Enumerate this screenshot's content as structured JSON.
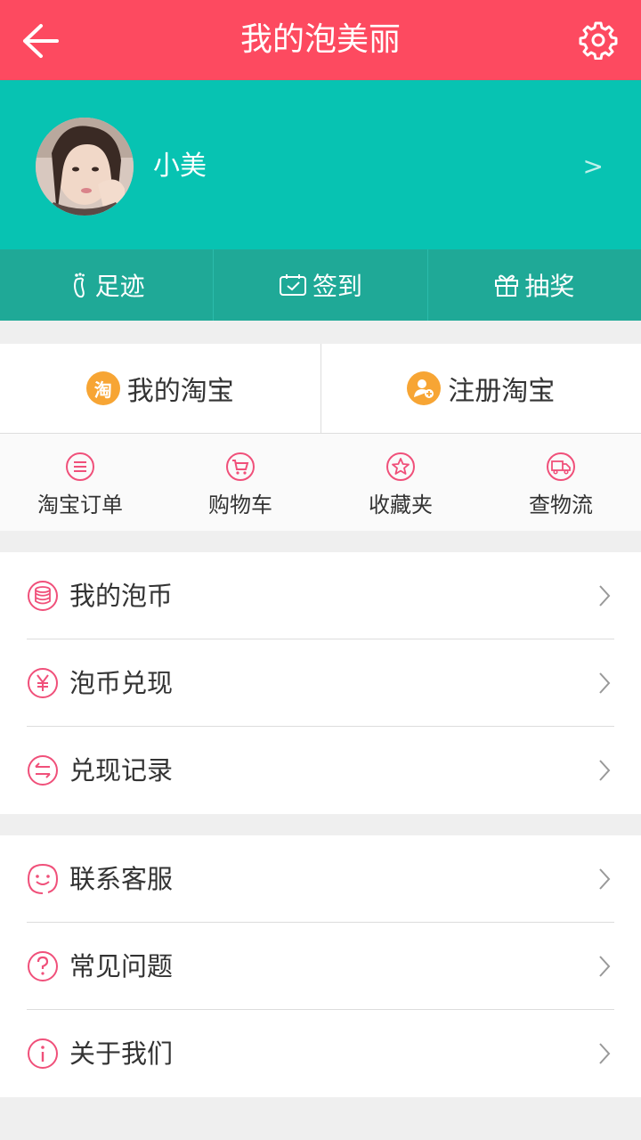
{
  "header": {
    "title": "我的泡美丽",
    "back_icon": "arrow-left-icon",
    "settings_icon": "gear-icon"
  },
  "profile": {
    "username": "小美",
    "chevron": ">"
  },
  "actions": [
    {
      "label": "足迹",
      "icon": "footprint-icon"
    },
    {
      "label": "签到",
      "icon": "calendar-check-icon"
    },
    {
      "label": "抽奖",
      "icon": "gift-icon"
    }
  ],
  "taobao": [
    {
      "label": "我的淘宝",
      "icon_char": "淘"
    },
    {
      "label": "注册淘宝",
      "icon": "add-user-icon"
    }
  ],
  "quick": [
    {
      "label": "淘宝订单",
      "icon": "list-icon"
    },
    {
      "label": "购物车",
      "icon": "cart-icon"
    },
    {
      "label": "收藏夹",
      "icon": "star-icon"
    },
    {
      "label": "查物流",
      "icon": "truck-icon"
    }
  ],
  "group1": [
    {
      "label": "我的泡币",
      "icon": "coins-icon"
    },
    {
      "label": "泡币兑现",
      "icon": "yen-icon"
    },
    {
      "label": "兑现记录",
      "icon": "exchange-icon"
    }
  ],
  "group2": [
    {
      "label": "联系客服",
      "icon": "service-face-icon"
    },
    {
      "label": "常见问题",
      "icon": "question-icon"
    },
    {
      "label": "关于我们",
      "icon": "info-icon"
    }
  ],
  "colors": {
    "header": "#fd4a60",
    "profile": "#07c3b2",
    "actions": "#1fa997",
    "accent": "#f0507a",
    "taobao_orange": "#f7a534"
  }
}
